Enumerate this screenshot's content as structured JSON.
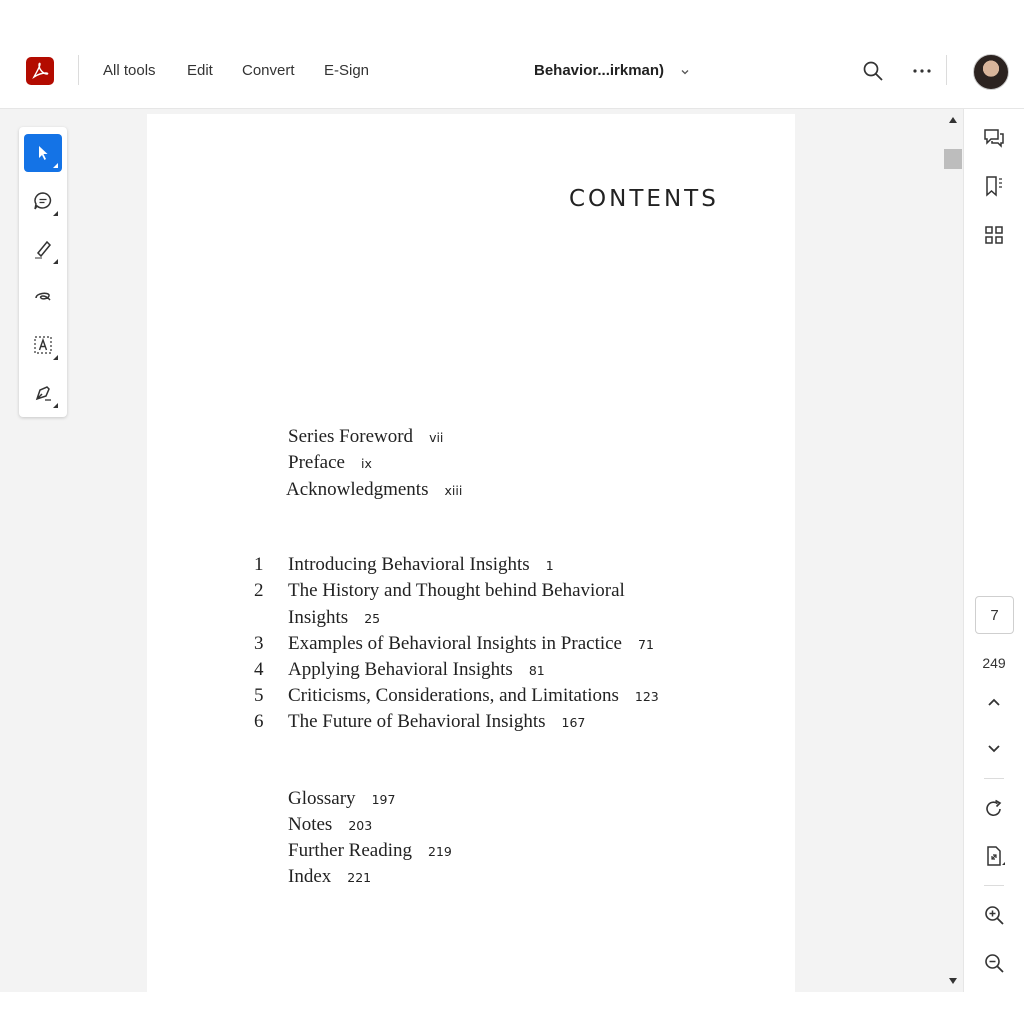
{
  "header": {
    "nav": [
      "All tools",
      "Edit",
      "Convert",
      "E-Sign"
    ],
    "doc_title": "Behavior...irkman)"
  },
  "icons": {
    "app_logo": "acrobat-logo-icon",
    "search": "search-icon",
    "more": "more-icon",
    "avatar": "avatar"
  },
  "colors": {
    "brand": "#b30b00",
    "accent": "#1473e6"
  },
  "document": {
    "heading": "CONTENTS",
    "front_matter": [
      {
        "title": "Series Foreword",
        "page": "vii"
      },
      {
        "title": "Preface",
        "page": "ix"
      },
      {
        "title": "Acknowledgments",
        "page": "xiii"
      }
    ],
    "chapters": [
      {
        "num": "1",
        "title": "Introducing Behavioral Insights",
        "page": "1"
      },
      {
        "num": "2",
        "title": "The History and Thought behind Behavioral",
        "title_cont": "Insights",
        "page": "25"
      },
      {
        "num": "3",
        "title": "Examples of Behavioral Insights in Practice",
        "page": "71"
      },
      {
        "num": "4",
        "title": "Applying Behavioral Insights",
        "page": "81"
      },
      {
        "num": "5",
        "title": "Criticisms, Considerations, and Limitations",
        "page": "123"
      },
      {
        "num": "6",
        "title": "The Future of Behavioral Insights",
        "page": "167"
      }
    ],
    "back_matter": [
      {
        "title": "Glossary",
        "page": "197"
      },
      {
        "title": "Notes",
        "page": "203"
      },
      {
        "title": "Further Reading",
        "page": "219"
      },
      {
        "title": "Index",
        "page": "221"
      }
    ]
  },
  "pagination": {
    "current": "7",
    "total": "249"
  }
}
